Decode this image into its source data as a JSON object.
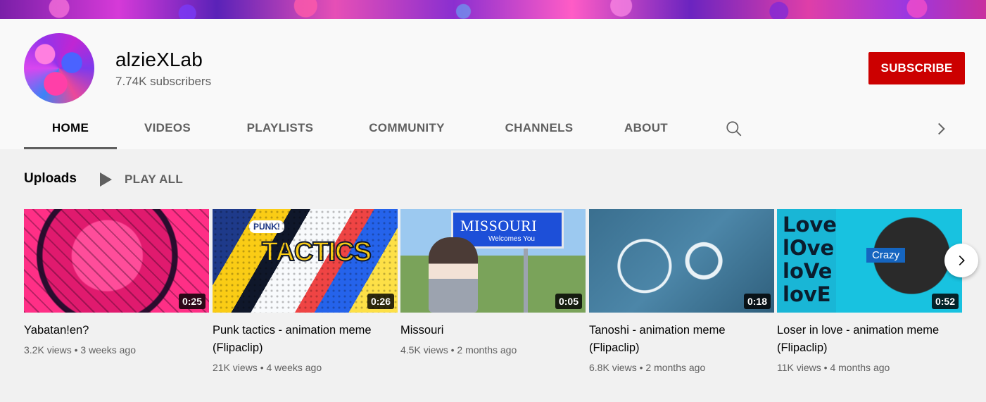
{
  "channel": {
    "name": "alzieXLab",
    "subscribers": "7.74K subscribers",
    "subscribe_label": "SUBSCRIBE"
  },
  "tabs": [
    {
      "label": "HOME",
      "active": true
    },
    {
      "label": "VIDEOS"
    },
    {
      "label": "PLAYLISTS"
    },
    {
      "label": "COMMUNITY"
    },
    {
      "label": "CHANNELS"
    },
    {
      "label": "ABOUT"
    }
  ],
  "icons": {
    "search": "search-icon",
    "tabs_next": "chevron-right-icon",
    "play": "play-icon",
    "carousel_next": "chevron-right-icon"
  },
  "uploads": {
    "title": "Uploads",
    "play_all": "PLAY ALL",
    "videos": [
      {
        "title": "Yabatan!en?",
        "duration": "0:25",
        "views": "3.2K views",
        "age": "3 weeks ago"
      },
      {
        "title": "Punk tactics - animation meme (Flipaclip)",
        "duration": "0:26",
        "views": "21K views",
        "age": "4 weeks ago",
        "thumb_text_1": "PUNK!",
        "thumb_text_2": "TACTICS"
      },
      {
        "title": "Missouri",
        "duration": "0:05",
        "views": "4.5K views",
        "age": "2 months ago",
        "thumb_text_1": "MISSOURI",
        "thumb_text_2": "Welcomes You"
      },
      {
        "title": "Tanoshi - animation meme (Flipaclip)",
        "duration": "0:18",
        "views": "6.8K views",
        "age": "2 months ago"
      },
      {
        "title": "Loser in love - animation meme (Flipaclip)",
        "duration": "0:52",
        "views": "11K views",
        "age": "4 months ago",
        "thumb_lines": [
          "Love",
          "lOve",
          "loVe",
          "lovE"
        ],
        "thumb_badge": "Crazy"
      }
    ]
  },
  "colors": {
    "subscribe_bg": "#cc0000",
    "page_bg": "#f9f9f9",
    "content_bg": "#f1f1f1",
    "secondary_text": "#606060"
  }
}
